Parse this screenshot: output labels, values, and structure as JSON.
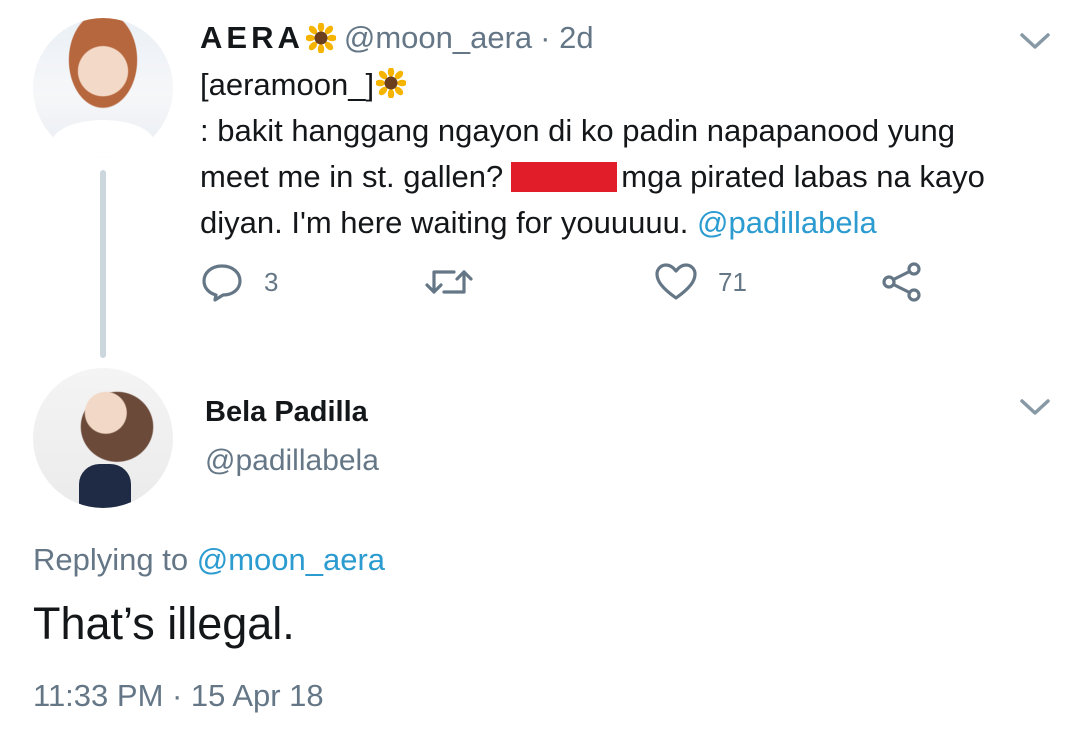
{
  "tweet_1": {
    "author_name": "AERA",
    "handle": "@moon_aera",
    "time_ago": "· 2d",
    "avatar_icon": "profile-photo-woman",
    "name_emoji": "sunflower-icon",
    "body_lines": {
      "line1": "[aeramoon_]",
      "line2": ": bakit hanggang ngayon di ko padin napapanood yung",
      "line3a": "meet me in st. gallen?",
      "line3b": "mga pirated labas na kayo",
      "line4": "diyan. I'm here waiting for youuuuu.",
      "mention": "@padillabela"
    },
    "actions": {
      "reply_count": "3",
      "retweet_count": "",
      "like_count": "71"
    }
  },
  "tweet_2": {
    "author_name": "Bela Padilla",
    "handle": "@padillabela",
    "avatar_icon": "profile-photo-woman",
    "replying_prefix": "Replying to",
    "replying_to": "@moon_aera",
    "text": "That’s illegal.",
    "timestamp": "11:33 PM · 15 Apr 18"
  },
  "colors": {
    "text_primary": "#14171a",
    "text_secondary": "#657786",
    "link": "#2b9bd0",
    "redaction": "#e11d2a",
    "thread_line": "#ccd6dd"
  }
}
